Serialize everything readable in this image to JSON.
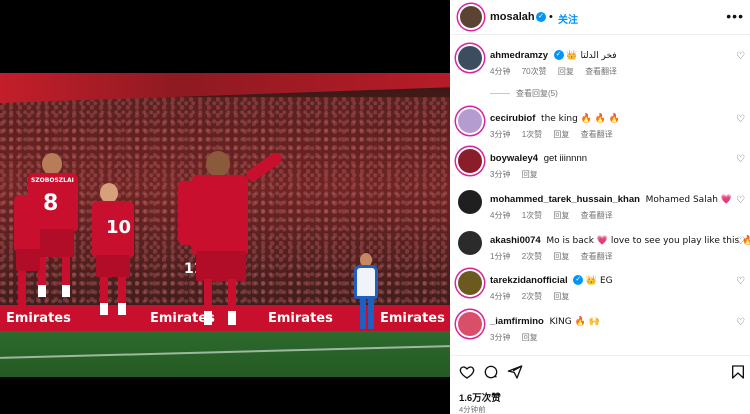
{
  "post": {
    "username": "mosalah",
    "follow_label": "关注",
    "more_label": "•••",
    "likes": "1.6万次赞",
    "posted_ago": "4分钟前"
  },
  "photo": {
    "board_bottom_texts": [
      "Emirates",
      "Emirates",
      "Emirates",
      "Emirates"
    ],
    "player_numbers": [
      "8",
      "10",
      "11"
    ],
    "player_name": "SZOBOSZLAI"
  },
  "comments": [
    {
      "username": "ahmedramzy",
      "verified": true,
      "text": "👑 فخر الدلتا",
      "time": "4分钟",
      "likes": "70次赞",
      "reply": "回复",
      "translate": "查看翻译",
      "avatar_color": "#3b4d5e"
    },
    {
      "username": "cecirubiof",
      "verified": false,
      "text": "the king 🔥 🔥 🔥",
      "time": "3分钟",
      "likes": "1次赞",
      "reply": "回复",
      "translate": "查看翻译",
      "avatar_color": "#b49bd0"
    },
    {
      "username": "boywaley4",
      "verified": false,
      "text": "get iiinnnn",
      "time": "3分钟",
      "likes": "",
      "reply": "回复",
      "translate": "",
      "avatar_color": "#8a1d2a"
    },
    {
      "username": "mohammed_tarek_hussain_khan",
      "verified": false,
      "text": "Mohamed Salah 💗",
      "time": "4分钟",
      "likes": "1次赞",
      "reply": "回复",
      "translate": "查看翻译",
      "avatar_color": "#1f1f1f"
    },
    {
      "username": "akashi0074",
      "verified": false,
      "text": "Mo is back 💗 love to see you play like this 🔥 🔥",
      "time": "1分钟",
      "likes": "2次赞",
      "reply": "回复",
      "translate": "查看翻译",
      "avatar_color": "#2b2b2b"
    },
    {
      "username": "tarekzidanofficial",
      "verified": true,
      "text": "👑 EG",
      "time": "4分钟",
      "likes": "2次赞",
      "reply": "回复",
      "translate": "",
      "avatar_color": "#6b5a1f"
    },
    {
      "username": "_iamfirmino",
      "verified": false,
      "text": "KING 🔥 🙌",
      "time": "3分钟",
      "likes": "",
      "reply": "回复",
      "translate": "",
      "avatar_color": "#d94f6a"
    }
  ],
  "view_replies_label": "查看回复(5)",
  "icons": [
    "heart-icon",
    "comment-icon",
    "share-icon",
    "bookmark-icon",
    "verified-icon"
  ],
  "colors": {
    "accent": "#0095f6",
    "brand_ring": "#d6249f",
    "liverpool_red": "#c8102e"
  }
}
